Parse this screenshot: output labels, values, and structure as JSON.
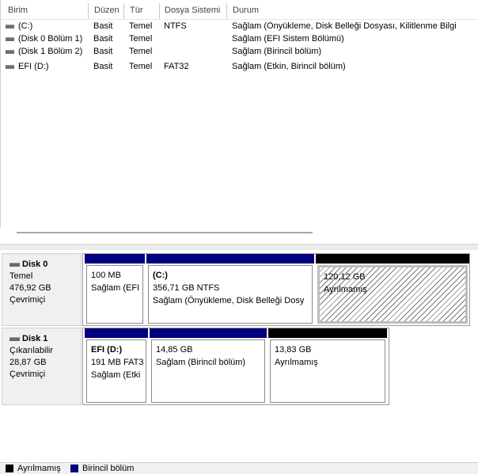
{
  "columns": [
    "Birim",
    "Düzen",
    "Tür",
    "Dosya Sistemi",
    "Durum"
  ],
  "volumes": [
    {
      "name": "(C:)",
      "layout": "Basit",
      "type": "Temel",
      "fs": "NTFS",
      "status": "Sağlam (Önyükleme, Disk Belleği Dosyası, Kilitlenme Bilgi"
    },
    {
      "name": "(Disk 0 Bölüm 1)",
      "layout": "Basit",
      "type": "Temel",
      "fs": "",
      "status": "Sağlam (EFI Sistem Bölümü)"
    },
    {
      "name": "(Disk 1 Bölüm 2)",
      "layout": "Basit",
      "type": "Temel",
      "fs": "",
      "status": "Sağlam (Birincil bölüm)"
    },
    {
      "name": "EFI (D:)",
      "layout": "Basit",
      "type": "Temel",
      "fs": "FAT32",
      "status": "Sağlam (Etkin, Birincil bölüm)"
    }
  ],
  "disks": [
    {
      "name": "Disk 0",
      "kind": "Temel",
      "size": "476,92 GB",
      "state": "Çevrimiçi",
      "partitions": [
        {
          "title": "",
          "size": "100 MB",
          "status": "Sağlam (EFI",
          "bar_color": "#000080",
          "unallocated": false
        },
        {
          "title": "(C:)",
          "size": "356,71 GB NTFS",
          "status": "Sağlam (Önyükleme, Disk Belleği Dosy",
          "bar_color": "#000080",
          "unallocated": false
        },
        {
          "title": "",
          "size": "120,12 GB",
          "status": "Ayrılmamış",
          "bar_color": "#000000",
          "unallocated": true
        }
      ]
    },
    {
      "name": "Disk 1",
      "kind": "Çıkarılabilir",
      "size": "28,87 GB",
      "state": "Çevrimiçi",
      "partitions": [
        {
          "title": "EFI  (D:)",
          "size": "191 MB FAT3",
          "status": "Sağlam (Etki",
          "bar_color": "#000080",
          "unallocated": false
        },
        {
          "title": "",
          "size": "14,85 GB",
          "status": "Sağlam (Birincil bölüm)",
          "bar_color": "#000080",
          "unallocated": false
        },
        {
          "title": "",
          "size": "13,83 GB",
          "status": "Ayrılmamış",
          "bar_color": "#000000",
          "unallocated": false
        }
      ]
    }
  ],
  "legend": [
    {
      "label": "Ayrılmamış",
      "color": "#000000"
    },
    {
      "label": "Birincil bölüm",
      "color": "#000080"
    }
  ]
}
